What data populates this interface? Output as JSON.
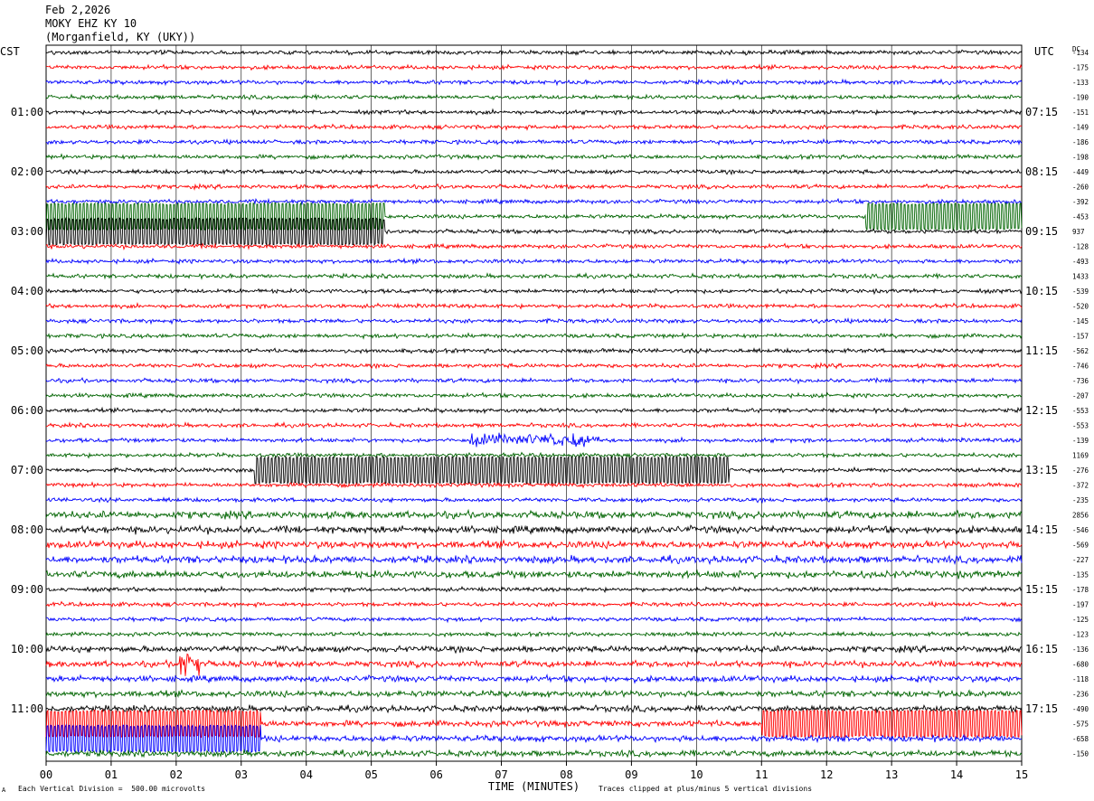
{
  "header": {
    "date": "Feb 2,2026",
    "station": "MOKY EHZ KY 10",
    "location": "(Morganfield, KY (UKY))"
  },
  "footer": {
    "scale_note": "Each Vertical Division =  500.00 microvolts",
    "clip_note": "Traces clipped at plus/minus 5 vertical divisions",
    "corner_mark": "A"
  },
  "colors": {
    "trace_cycle": [
      "#000000",
      "#ff0000",
      "#0000ff",
      "#006400"
    ],
    "grid": "#000000"
  },
  "chart_data": {
    "type": "line",
    "title": "",
    "xlabel": "TIME (MINUTES)",
    "ylabel": "",
    "left_axis_label": "CST",
    "right_axis_label": "UTC",
    "dc_label": "DC",
    "xlim": [
      0,
      15
    ],
    "x_ticks": [
      "00",
      "01",
      "02",
      "03",
      "04",
      "05",
      "06",
      "07",
      "08",
      "09",
      "10",
      "11",
      "12",
      "13",
      "14",
      "15"
    ],
    "rows": 48,
    "cst_hour_labels": [
      "01:00",
      "02:00",
      "03:00",
      "04:00",
      "05:00",
      "06:00",
      "07:00",
      "08:00",
      "09:00",
      "10:00",
      "11:00"
    ],
    "utc_hour_labels": [
      "07:15",
      "08:15",
      "09:15",
      "10:15",
      "11:15",
      "12:15",
      "13:15",
      "14:15",
      "15:15",
      "16:15",
      "17:15"
    ],
    "hour_label_rows": [
      4,
      8,
      12,
      16,
      20,
      24,
      28,
      32,
      36,
      40,
      44
    ],
    "dc_offsets": [
      "-134",
      "-175",
      "-133",
      "-190",
      "-151",
      "-149",
      "-186",
      "-198",
      "-449",
      "-260",
      "-392",
      "-453",
      "937",
      "-128",
      "-493",
      "1433",
      "-539",
      "-520",
      "-145",
      "-157",
      "-562",
      "-746",
      "-736",
      "-207",
      "-553",
      "-553",
      "-139",
      "1169",
      "-276",
      "-372",
      "-235",
      "2856",
      "-546",
      "-569",
      "-227",
      "-135",
      "-178",
      "-197",
      "-125",
      "-123",
      "-136",
      "-680",
      "-118",
      "-236",
      "-490",
      "-575",
      "-658",
      "-150"
    ],
    "events": [
      {
        "row": 11,
        "start_min": 12.6,
        "end_min": 15.0,
        "kind": "clipped"
      },
      {
        "row": 11,
        "start_min": 0.0,
        "end_min": 5.2,
        "kind": "clipped"
      },
      {
        "row": 12,
        "start_min": 0.0,
        "end_min": 5.2,
        "kind": "clipped"
      },
      {
        "row": 28,
        "start_min": 3.2,
        "end_min": 10.5,
        "kind": "clipped"
      },
      {
        "row": 26,
        "start_min": 6.5,
        "end_min": 8.5,
        "kind": "burst"
      },
      {
        "row": 41,
        "start_min": 2.05,
        "end_min": 2.35,
        "kind": "spike"
      },
      {
        "row": 45,
        "start_min": 11.0,
        "end_min": 15.0,
        "kind": "clipped"
      },
      {
        "row": 45,
        "start_min": 0.0,
        "end_min": 3.3,
        "kind": "clipped"
      },
      {
        "row": 46,
        "start_min": 0.0,
        "end_min": 3.3,
        "kind": "clipped"
      }
    ]
  }
}
